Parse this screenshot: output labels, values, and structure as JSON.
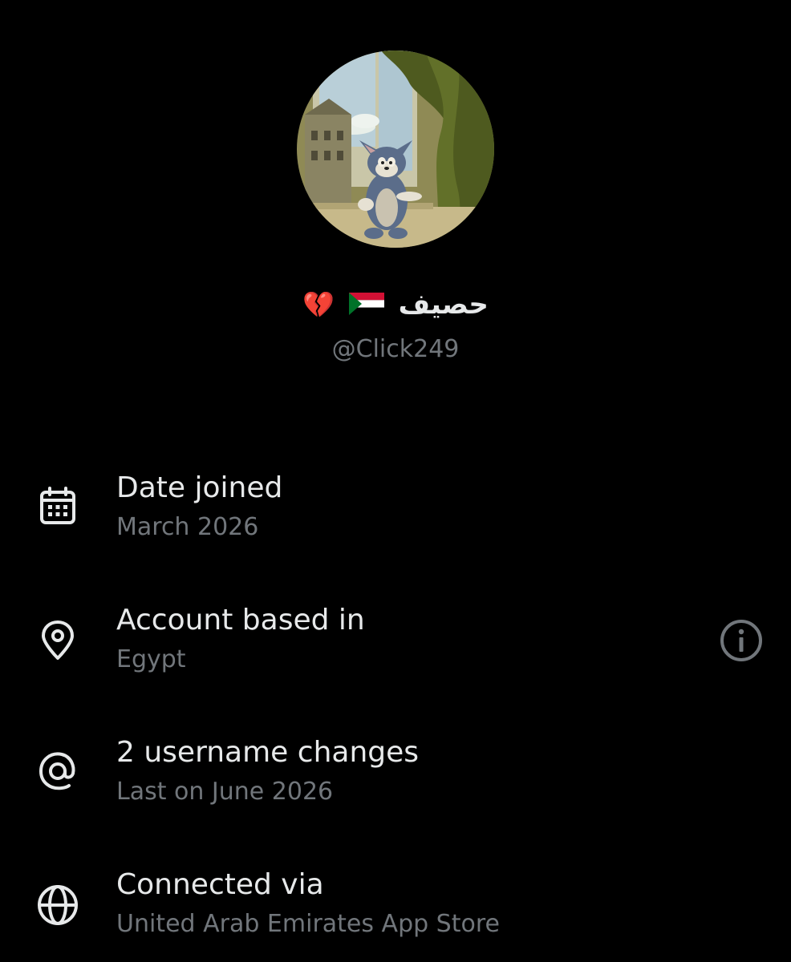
{
  "profile": {
    "display_name": "حصيف",
    "emoji_broken_heart": "💔",
    "handle": "@Click249"
  },
  "about": {
    "items": [
      {
        "icon": "calendar-icon",
        "title": "Date joined",
        "subtitle": "March 2026"
      },
      {
        "icon": "location-pin-icon",
        "title": "Account based in",
        "subtitle": "Egypt",
        "action_icon": "info-icon"
      },
      {
        "icon": "at-sign-icon",
        "title": "2 username changes",
        "subtitle": "Last on June 2026"
      },
      {
        "icon": "globe-icon",
        "title": "Connected via",
        "subtitle": "United Arab Emirates App Store"
      }
    ]
  },
  "colors": {
    "background": "#000000",
    "primary_text": "#e7e9ea",
    "secondary_text": "#71767b",
    "icon": "#e7e9ea",
    "info_icon": "#71767b"
  }
}
